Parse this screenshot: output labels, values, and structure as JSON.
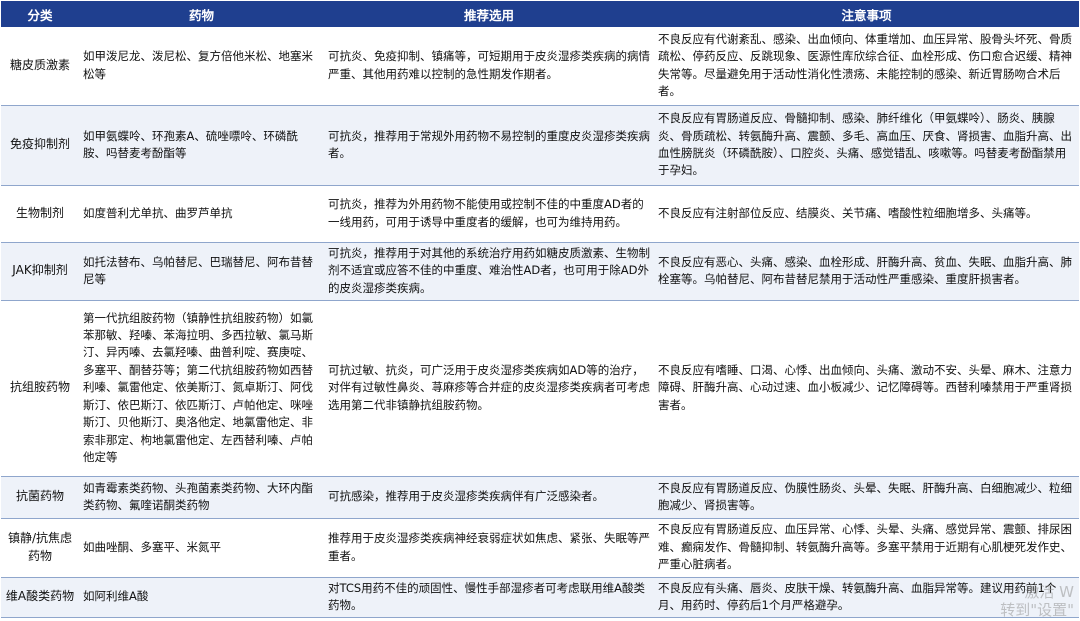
{
  "headers": [
    "分类",
    "药物",
    "推荐选用",
    "注意事项"
  ],
  "rows": [
    {
      "category": "糖皮质激素",
      "drugs": "如甲泼尼龙、泼尼松、复方倍他米松、地塞米松等",
      "recommend": "可抗炎、免疫抑制、镇痛等，可短期用于皮炎湿疹类疾病的病情严重、其他用药难以控制的急性期发作期者。",
      "notes": "不良反应有代谢紊乱、感染、出血倾向、体重增加、血压异常、股骨头坏死、骨质疏松、停药反应、反跳现象、医源性库欣综合征、血栓形成、伤口愈合迟缓、精神失常等。尽量避免用于活动性消化性溃疡、未能控制的感染、新近胃肠吻合术后者。"
    },
    {
      "category": "免疫抑制剂",
      "drugs": "如甲氨蝶呤、环孢素A、硫唑嘌呤、环磷酰胺、吗替麦考酚酯等",
      "recommend": "可抗炎，推荐用于常规外用药物不易控制的重度皮炎湿疹类疾病者。",
      "notes": "不良反应有胃肠道反应、骨髓抑制、感染、肺纤维化（甲氨蝶呤）、肠炎、胰腺炎、骨质疏松、转氨酶升高、震颤、多毛、高血压、厌食、肾损害、血脂升高、出血性膀胱炎（环磷酰胺）、口腔炎、头痛、感觉错乱、咳嗽等。吗替麦考酚酯禁用于孕妇。"
    },
    {
      "category": "生物制剂",
      "drugs": "如度普利尤单抗、曲罗芦单抗",
      "recommend": "可抗炎，推荐为外用药物不能使用或控制不佳的中重度AD者的一线用药，可用于诱导中重度者的缓解，也可为维持用药。",
      "notes": "不良反应有注射部位反应、结膜炎、关节痛、嗜酸性粒细胞增多、头痛等。"
    },
    {
      "category": "JAK抑制剂",
      "drugs": "如托法替布、乌帕替尼、巴瑞替尼、阿布昔替尼等",
      "recommend": "可抗炎，推荐用于对其他的系统治疗用药如糖皮质激素、生物制剂不适宜或应答不佳的中重度、难治性AD者，也可用于除AD外的皮炎湿疹类疾病。",
      "notes": "不良反应有恶心、头痛、感染、血栓形成、肝酶升高、贫血、失眠、血脂升高、肺栓塞等。乌帕替尼、阿布昔替尼禁用于活动性严重感染、重度肝损害者。"
    },
    {
      "category": "抗组胺药物",
      "drugs": "第一代抗组胺药物（镇静性抗组胺药物）如氯苯那敏、羟嗪、苯海拉明、多西拉敏、氯马斯汀、异丙嗪、去氯羟嗪、曲普利啶、赛庚啶、多塞平、酮替芬等；第二代抗组胺药物如西替利嗪、氯雷他定、依美斯汀、氮卓斯汀、阿伐斯汀、依巴斯汀、依匹斯汀、卢帕他定、咪唑斯汀、贝他斯汀、奥洛他定、地氯雷他定、非索非那定、枸地氯雷他定、左西替利嗪、卢帕他定等",
      "recommend": "可抗过敏、抗炎，可广泛用于皮炎湿疹类疾病如AD等的治疗，对伴有过敏性鼻炎、荨麻疹等合并症的皮炎湿疹类疾病者可考虑选用第二代非镇静抗组胺药物。",
      "notes": "不良反应有嗜睡、口渴、心悸、出血倾向、头痛、激动不安、头晕、麻木、注意力障碍、肝酶升高、心动过速、血小板减少、记忆障碍等。西替利嗪禁用于严重肾损害者。"
    },
    {
      "category": "抗菌药物",
      "drugs": "如青霉素类药物、头孢菌素类药物、大环内酯类药物、氟喹诺酮类药物",
      "recommend": "可抗感染，推荐用于皮炎湿疹类疾病伴有广泛感染者。",
      "notes": "不良反应有胃肠道反应、伪膜性肠炎、头晕、失眠、肝酶升高、白细胞减少、粒细胞减少、肾损害等。"
    },
    {
      "category": "镇静/抗焦虑药物",
      "drugs": "如曲唑酮、多塞平、米氮平",
      "recommend": "推荐用于皮炎湿疹类疾病神经衰弱症状如焦虑、紧张、失眠等严重者。",
      "notes": "不良反应有胃肠道反应、血压异常、心悸、头晕、头痛、感觉异常、震颤、排尿困难、癫痫发作、骨髓抑制、转氨酶升高等。多塞平禁用于近期有心肌梗死发作史、严重心脏病者。"
    },
    {
      "category": "维A酸类药物",
      "drugs": "如阿利维A酸",
      "recommend": "对TCS用药不佳的顽固性、慢性手部湿疹者可考虑联用维A酸类药物。",
      "notes": "不良反应有头痛、唇炎、皮肤干燥、转氨酶升高、血脂异常等。建议用药前1个月、用药时、停药后1个月严格避孕。"
    }
  ],
  "watermark": {
    "line1": "激活 W",
    "line2": "转到\"设置\""
  }
}
